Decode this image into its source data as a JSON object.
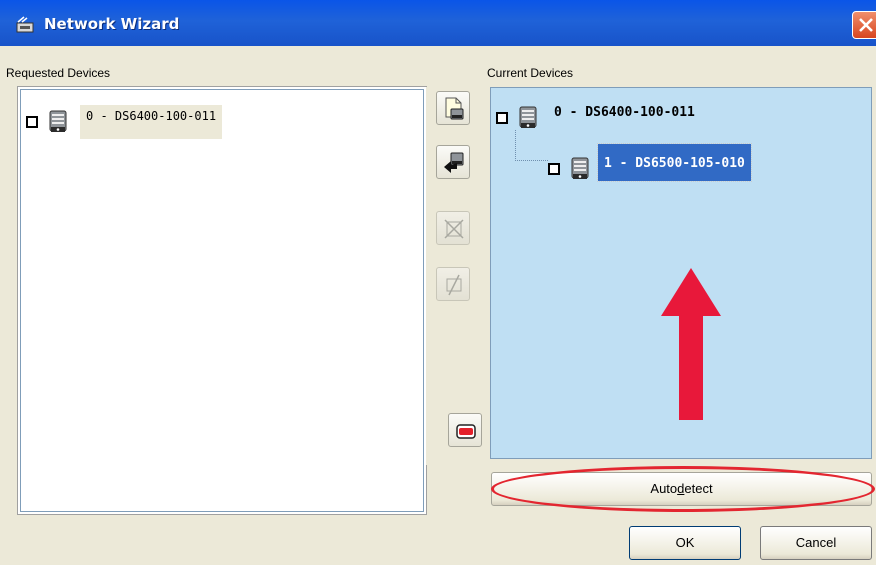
{
  "window": {
    "title": "Network Wizard",
    "title_icon": "network-wizard-icon",
    "close_icon": "close-icon"
  },
  "requested": {
    "heading": "Requested Devices",
    "items": [
      {
        "label": "0 - DS6400-100-011",
        "checked": false,
        "icon": "device-icon"
      }
    ]
  },
  "current": {
    "heading": "Current Devices",
    "items": [
      {
        "label": "0 - DS6400-100-011",
        "checked": false,
        "icon": "device-icon"
      },
      {
        "label": "1 - DS6500-105-010",
        "checked": false,
        "icon": "device-icon",
        "selected": true
      }
    ],
    "background": "#bfdff3",
    "selection_color": "#316ac5"
  },
  "toolbar": {
    "items": [
      {
        "icon": "copy-device-icon",
        "enabled": true
      },
      {
        "icon": "move-left-icon",
        "enabled": true
      },
      {
        "icon": "remove-device-icon",
        "enabled": false
      },
      {
        "icon": "disable-device-icon",
        "enabled": false
      },
      {
        "icon": "device-status-icon",
        "enabled": true
      }
    ]
  },
  "buttons": {
    "autodetect_pre": "Auto",
    "autodetect_mnemonic": "d",
    "autodetect_post": "etect",
    "ok": "OK",
    "cancel": "Cancel"
  },
  "annotations": {
    "arrow_color": "#e8183a",
    "ellipse_color": "#e32630"
  }
}
